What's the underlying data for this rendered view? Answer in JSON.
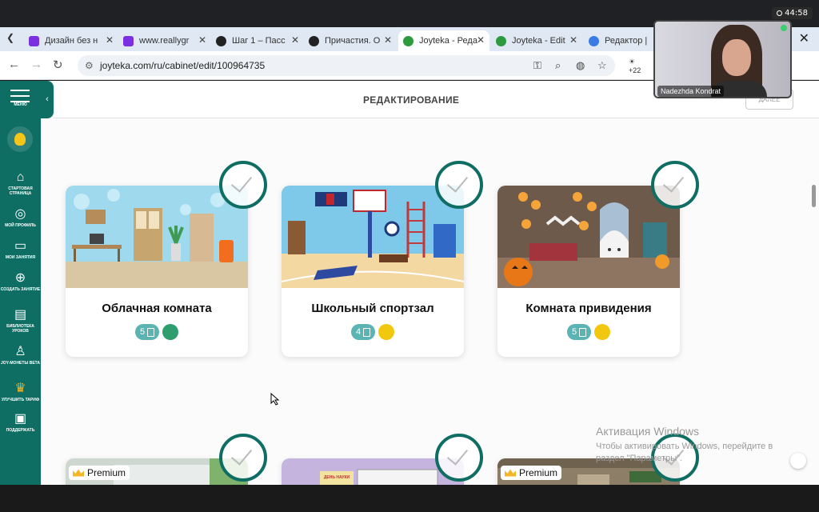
{
  "clock": "44:58",
  "tabs": [
    {
      "label": "Дизайн без н",
      "color": "#7a2fe0"
    },
    {
      "label": "www.reallygr",
      "color": "#7a2fe0"
    },
    {
      "label": "Шаг 1 – Пасс",
      "color": "#222222"
    },
    {
      "label": "Причастия. О",
      "color": "#222222"
    },
    {
      "label": "Joyteka - Реда",
      "color": "#2e9a3e"
    },
    {
      "label": "Joyteka - Edit",
      "color": "#2e9a3e"
    },
    {
      "label": "Редактор | In",
      "color": "#3b7be6"
    }
  ],
  "address": {
    "url": "joyteka.com/ru/cabinet/edit/100964735",
    "weather": "+22"
  },
  "sidebar": {
    "menu_label": "МЕНЮ",
    "items": [
      {
        "icon": "⌂",
        "label": "СТАРТОВАЯ СТРАНИЦА"
      },
      {
        "icon": "◎",
        "label": "МОЙ ПРОФИЛЬ"
      },
      {
        "icon": "▭",
        "label": "МОИ ЗАНЯТИЯ"
      },
      {
        "icon": "⊕",
        "label": "СОЗДАТЬ ЗАНЯТИЕ"
      },
      {
        "icon": "▤",
        "label": "БИБЛИОТЕКА УРОКОВ"
      },
      {
        "icon": "♙",
        "label": "JOY-МОНЕТЫ BETA"
      },
      {
        "icon": "♛",
        "label": "УЛУЧШИТЬ ТАРИФ"
      },
      {
        "icon": "▣",
        "label": "ПОДДЕРЖАТЬ"
      }
    ]
  },
  "header": {
    "title": "РЕДАКТИРОВАНИЕ",
    "next_label": "ДАЛЕЕ"
  },
  "rooms": [
    {
      "title": "Облачная комната",
      "count": "5",
      "dot_color": "#2e9e6e"
    },
    {
      "title": "Школьный спортзал",
      "count": "4",
      "dot_color": "#f2c80f"
    },
    {
      "title": "Комната привидения",
      "count": "5",
      "dot_color": "#f2c80f"
    }
  ],
  "premium_label": "Premium",
  "lower_card_banner": "ДЕНЬ НАУКИ",
  "watermark": {
    "title": "Активация Windows",
    "text": "Чтобы активировать Windows, перейдите в раздел \"Параметры\"."
  },
  "video": {
    "name": "Nadezhda Kondrat"
  }
}
